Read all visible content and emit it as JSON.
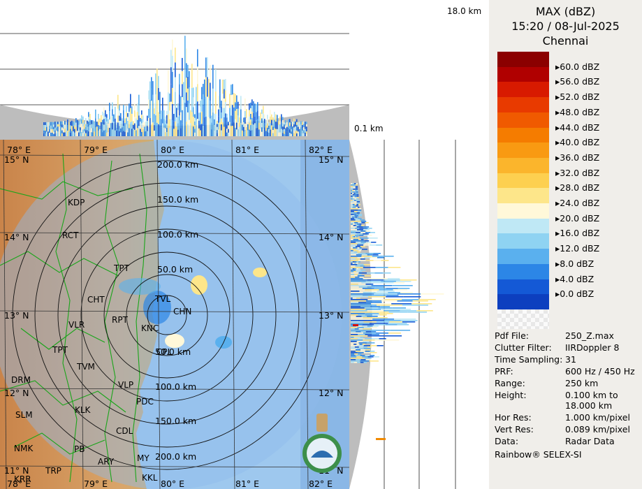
{
  "header": {
    "product": "MAX (dBZ)",
    "datetime": "15:20 / 08-Jul-2025",
    "station": "Chennai"
  },
  "side_labels": {
    "top_height": "18.0 km",
    "bottom_height": "0.1 km"
  },
  "legend": {
    "labels": [
      "60.0 dBZ",
      "56.0 dBZ",
      "52.0 dBZ",
      "48.0 dBZ",
      "44.0 dBZ",
      "40.0 dBZ",
      "36.0 dBZ",
      "32.0 dBZ",
      "28.0 dBZ",
      "24.0 dBZ",
      "20.0 dBZ",
      "16.0 dBZ",
      "12.0 dBZ",
      "8.0 dBZ",
      "4.0 dBZ",
      "0.0 dBZ"
    ],
    "colors": [
      "#8b0000",
      "#b00000",
      "#d81a00",
      "#e83a00",
      "#f05a00",
      "#f57c00",
      "#f99a12",
      "#fbb52c",
      "#fdd050",
      "#fde68a",
      "#fff8d9",
      "#bfe8f5",
      "#8fd3f2",
      "#5ab0ee",
      "#2c86e6",
      "#1459d6",
      "#0d3fbf"
    ]
  },
  "info": {
    "pdf_file_label": "Pdf File:",
    "pdf_file": "250_Z.max",
    "clutter_filter_label": "Clutter Filter:",
    "clutter_filter": "IIRDoppler 8",
    "time_sampling_label": "Time Sampling:",
    "time_sampling": "31",
    "prf_label": "PRF:",
    "prf": "600 Hz / 450 Hz",
    "range_label": "Range:",
    "range": "250 km",
    "height_label": "Height:",
    "height_line1": "0.100 km to",
    "height_line2": "18.000 km",
    "hor_res_label": "Hor Res:",
    "hor_res": "1.000 km/pixel",
    "vert_res_label": "Vert Res:",
    "vert_res": "0.089 km/pixel",
    "data_label": "Data:",
    "data": "Radar Data",
    "software": "Rainbow® SELEX-SI"
  },
  "range_rings": [
    "50.0 km",
    "100.0 km",
    "150.0 km",
    "200.0 km"
  ],
  "lon_labels": [
    "78° E",
    "79° E",
    "80° E",
    "81° E",
    "82° E"
  ],
  "lat_labels": [
    "15° N",
    "14° N",
    "13° N",
    "12° N",
    "11° N"
  ],
  "places": [
    "KDP",
    "RCT",
    "TPT",
    "CHT",
    "VLR",
    "RPT",
    "TPT",
    "TVM",
    "DRM",
    "SLM",
    "KLK",
    "VLP",
    "PDC",
    "CDL",
    "NMK",
    "PB",
    "ARY",
    "MY",
    "TRP",
    "KRR",
    "KKL",
    "TVL",
    "CHN",
    "KNC",
    "CPL"
  ]
}
